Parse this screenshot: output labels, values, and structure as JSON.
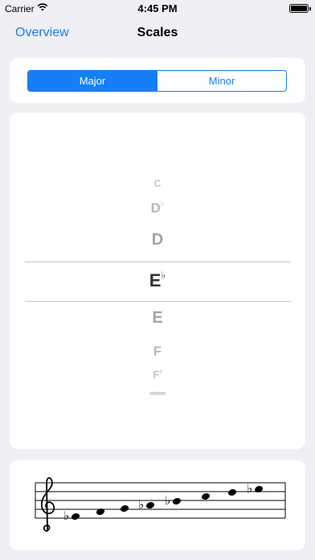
{
  "status_bar": {
    "carrier": "Carrier",
    "time": "4:45 PM"
  },
  "nav": {
    "back_label": "Overview",
    "title": "Scales"
  },
  "segment": {
    "options": [
      "Major",
      "Minor"
    ],
    "selected": "Major"
  },
  "picker": {
    "items": [
      {
        "note": "C",
        "accidental": ""
      },
      {
        "note": "D",
        "accidental": "♭"
      },
      {
        "note": "D",
        "accidental": ""
      },
      {
        "note": "E",
        "accidental": "♭"
      },
      {
        "note": "E",
        "accidental": ""
      },
      {
        "note": "F",
        "accidental": ""
      },
      {
        "note": "F",
        "accidental": "♯"
      }
    ],
    "selected_index": 3
  },
  "staff": {
    "clef": "treble",
    "notes": [
      "E♭",
      "F",
      "G",
      "A♭",
      "B♭",
      "C",
      "D",
      "E♭"
    ]
  }
}
